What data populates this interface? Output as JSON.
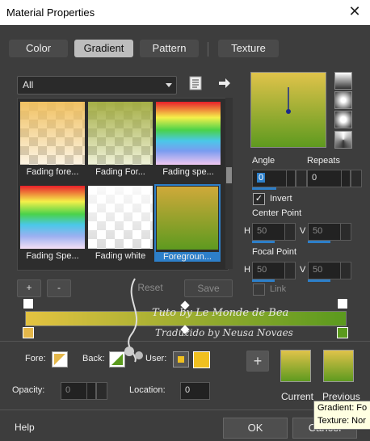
{
  "window": {
    "title": "Material Properties",
    "close": "✕"
  },
  "tabs": [
    {
      "label": "Color",
      "active": false
    },
    {
      "label": "Gradient",
      "active": true
    },
    {
      "label": "Pattern",
      "active": false
    },
    {
      "label": "Texture",
      "active": false
    }
  ],
  "category": {
    "value": "All"
  },
  "gallery": [
    {
      "caption": "Fading fore..."
    },
    {
      "caption": "Fading For..."
    },
    {
      "caption": "Fading spe..."
    },
    {
      "caption": "Fading Spe..."
    },
    {
      "caption": "Fading white"
    },
    {
      "caption": "Foregroun..."
    }
  ],
  "gallery_buttons": {
    "add": "+",
    "remove": "-",
    "reset": "Reset",
    "save": "Save"
  },
  "angle": {
    "label": "Angle",
    "value": "0"
  },
  "repeats": {
    "label": "Repeats",
    "value": "0"
  },
  "invert": {
    "label": "Invert",
    "checked": true
  },
  "center_point": {
    "label": "Center Point",
    "h_label": "H",
    "h_value": "50",
    "v_label": "V",
    "v_value": "50"
  },
  "focal_point": {
    "label": "Focal Point",
    "h_label": "H",
    "h_value": "50",
    "v_label": "V",
    "v_value": "50"
  },
  "link": {
    "label": "Link"
  },
  "fore_label": "Fore:",
  "back_label": "Back:",
  "user_label": "User:",
  "opacity": {
    "label": "Opacity:",
    "value": "0"
  },
  "location": {
    "label": "Location:",
    "value": "0"
  },
  "current_label": "Current",
  "previous_label": "Previous",
  "help_label": "Help",
  "ok_label": "OK",
  "cancel_label": "Cancel",
  "tooltip": {
    "line1": "Gradient: Fo",
    "line2": "Texture: Nor"
  },
  "watermark": {
    "line1": "Tuto by Le Monde de Bea",
    "line2": "Traduzido by Neusa Novaes"
  },
  "colors": {
    "gradient_start": "#e4c341",
    "gradient_end": "#5b9a1e",
    "accent": "#2d7fc9",
    "user_color": "#f0c020"
  }
}
